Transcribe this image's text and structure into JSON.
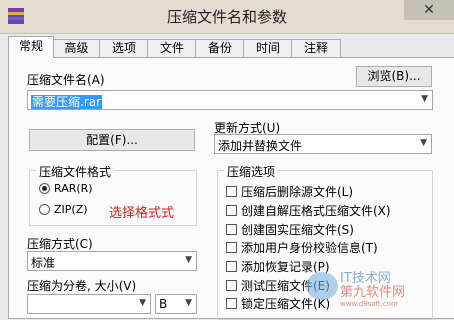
{
  "window": {
    "title": "压缩文件名和参数",
    "close_glyph": "✕"
  },
  "tabs": [
    "常规",
    "高级",
    "选项",
    "文件",
    "备份",
    "时间",
    "注释"
  ],
  "archive_name": {
    "label": "压缩文件名(A)",
    "value": "需要压缩.rar",
    "browse_button": "浏览(B)..."
  },
  "profiles_button": "配置(F)...",
  "update_mode": {
    "label": "更新方式(U)",
    "value": "添加并替换文件"
  },
  "archive_format": {
    "title": "压缩文件格式",
    "options": [
      "RAR(R)",
      "ZIP(Z)"
    ],
    "selected": "RAR(R)",
    "annotation": "选择格式式"
  },
  "compression_method": {
    "label": "压缩方式(C)",
    "value": "标准"
  },
  "split_volumes": {
    "label": "压缩为分卷, 大小(V)",
    "value": "",
    "unit": "B"
  },
  "archive_options": {
    "title": "压缩选项",
    "items": [
      "压缩后删除源文件(L)",
      "创建自解压格式压缩文件(X)",
      "创建固实压缩文件(S)",
      "添加用户身份校验信息(T)",
      "添加恢复记录(P)",
      "测试压缩文件(E)",
      "锁定压缩文件(K)"
    ]
  },
  "watermark": {
    "text1": "第九软件网",
    "text2": "www.d9soft.com",
    "text3": "IT技术网"
  }
}
